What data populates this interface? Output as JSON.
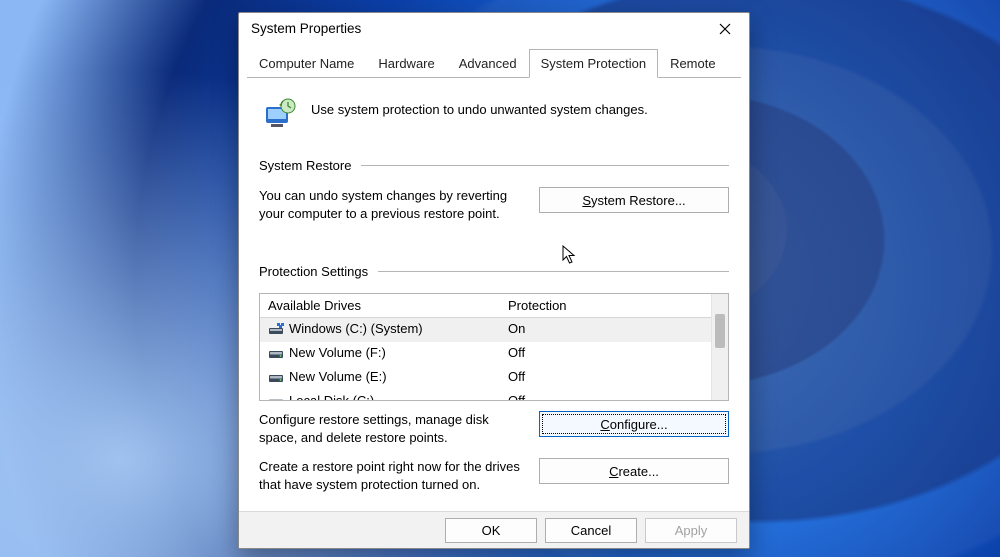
{
  "window": {
    "title": "System Properties"
  },
  "tabs": [
    {
      "label": "Computer Name"
    },
    {
      "label": "Hardware"
    },
    {
      "label": "Advanced"
    },
    {
      "label": "System Protection"
    },
    {
      "label": "Remote"
    }
  ],
  "intro": "Use system protection to undo unwanted system changes.",
  "sections": {
    "restore": {
      "header": "System Restore",
      "desc": "You can undo system changes by reverting your computer to a previous restore point.",
      "button_text": "ystem Restore...",
      "button_accel": "S"
    },
    "protection": {
      "header": "Protection Settings",
      "columns": {
        "drive": "Available Drives",
        "protection": "Protection"
      },
      "drives": [
        {
          "name": "Windows (C:) (System)",
          "protection": "On",
          "icon": "system"
        },
        {
          "name": "New Volume (F:)",
          "protection": "Off",
          "icon": "hdd"
        },
        {
          "name": "New Volume (E:)",
          "protection": "Off",
          "icon": "hdd"
        },
        {
          "name": "Local Disk (C:)",
          "protection": "Off",
          "icon": "hdd-faded"
        }
      ],
      "configure_desc": "Configure restore settings, manage disk space, and delete restore points.",
      "configure_button_text": "onfigure...",
      "configure_button_accel": "C",
      "create_desc": "Create a restore point right now for the drives that have system protection turned on.",
      "create_button_text": "reate...",
      "create_button_accel": "C"
    }
  },
  "footer": {
    "ok": "OK",
    "cancel": "Cancel",
    "apply": "Apply"
  }
}
